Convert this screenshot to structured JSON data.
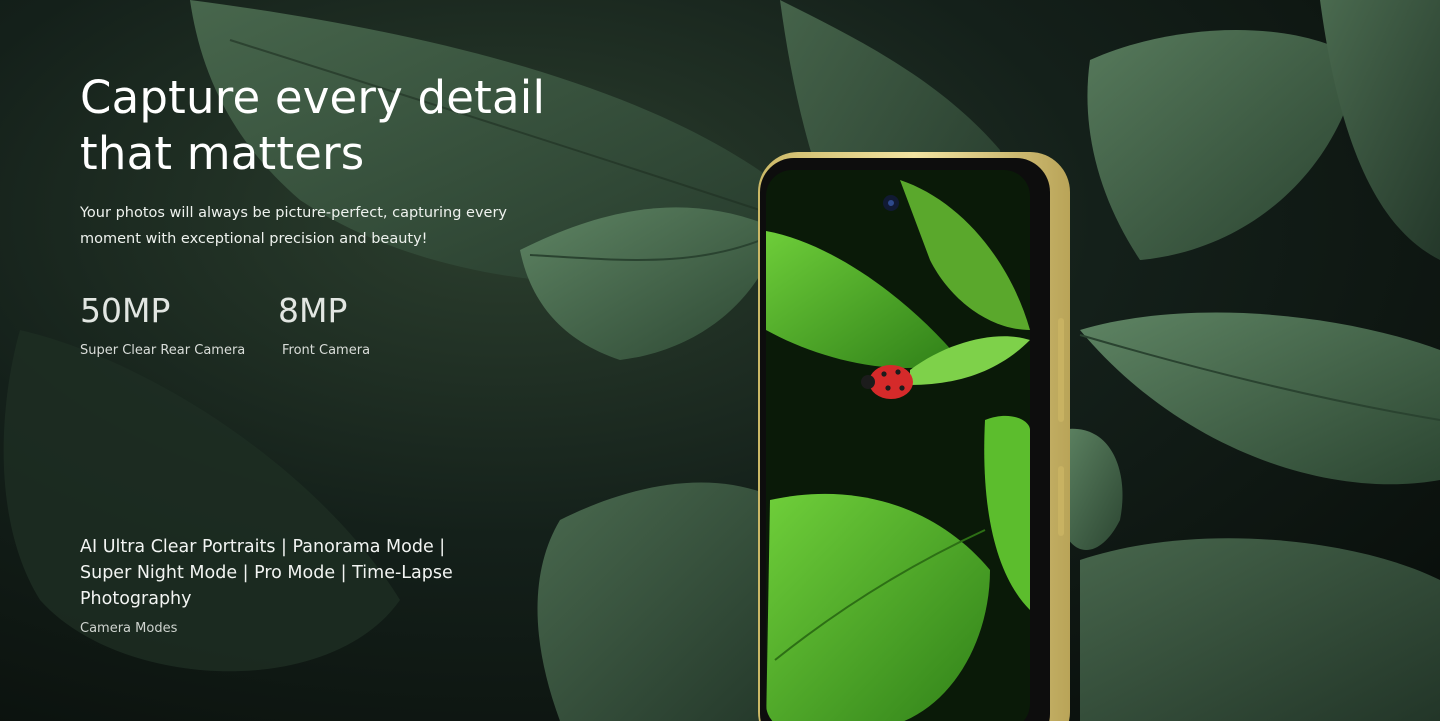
{
  "hero": {
    "headline": "Capture every detail that matters",
    "subtext": "Your photos will always be picture-perfect, capturing every moment with exceptional precision and beauty!",
    "specs": [
      {
        "value": "50MP",
        "label": "Super Clear Rear Camera"
      },
      {
        "value": "8MP",
        "label": "Front Camera"
      }
    ],
    "modes": "AI Ultra Clear Portraits | Panorama Mode | Super Night Mode | Pro Mode | Time-Lapse Photography",
    "modes_label": "Camera Modes"
  },
  "colors": {
    "leaf_dark": "#2f4a34",
    "leaf_mid": "#3f6246",
    "screen_leaf": "#3f9a1f",
    "phone_frame": "#e9d78f",
    "ladybug": "#d52a2a"
  }
}
